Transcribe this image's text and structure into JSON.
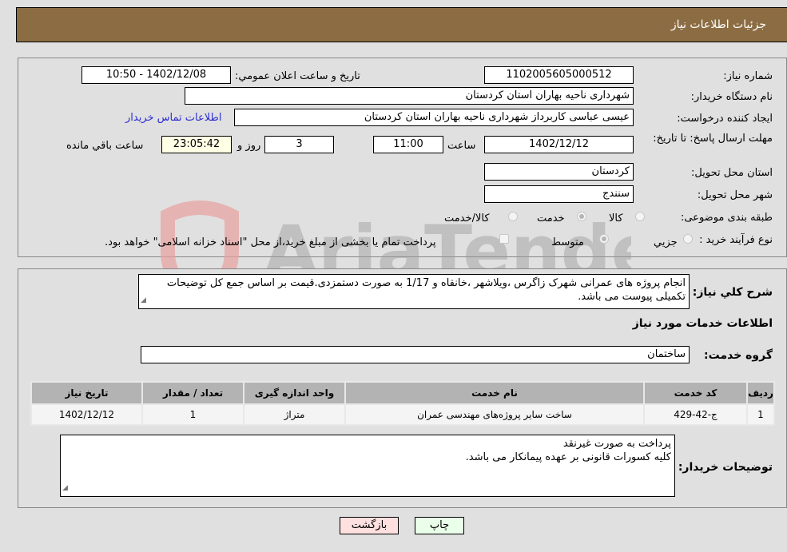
{
  "header": {
    "title": "جزئیات اطلاعات نیاز"
  },
  "form": {
    "need_number": {
      "label": "شماره نیاز:",
      "value": "1102005605000512"
    },
    "announce_datetime": {
      "label": "تاریخ و ساعت اعلان عمومي:",
      "value": "1402/12/08 - 10:50"
    },
    "buyer_org": {
      "label": "نام دستگاه خریدار:",
      "value": "شهرداری ناحیه بهاران استان کردستان"
    },
    "requester": {
      "label": "ایجاد کننده درخواست:",
      "value": "عیسی عباسی کاربرداز شهرداری ناحیه بهاران استان کردستان"
    },
    "buyer_contact_link": "اطلاعات تماس خریدار",
    "deadline": {
      "label": "مهلت ارسال پاسخ: تا تاریخ:",
      "date": "1402/12/12",
      "time_label": "ساعت",
      "time": "11:00",
      "days": "3",
      "days_label": "روز و",
      "remaining": "23:05:42",
      "remaining_label": "ساعت باقي مانده"
    },
    "delivery_province": {
      "label": "استان محل تحویل:",
      "value": "کردستان"
    },
    "delivery_city": {
      "label": "شهر محل تحویل:",
      "value": "سنندج"
    },
    "category": {
      "label": "طبقه بندی موضوعی:",
      "options": [
        "کالا",
        "خدمت",
        "کالا/خدمت"
      ],
      "selected": "خدمت"
    },
    "purchase_type": {
      "label": "نوع فرآیند خرید :",
      "options": [
        "جزيي",
        "متوسط"
      ],
      "selected": "متوسط",
      "treasury_note": "پرداخت تمام یا بخشی از مبلغ خرید،از محل \"اسناد خزانه اسلامی\" خواهد بود."
    }
  },
  "description": {
    "label": "شرح کلي نیاز:",
    "text": "انجام پروژه های عمرانی شهرک زاگرس ،ویلاشهر ،خانقاه و 1/17 به صورت دستمزدی.قیمت بر اساس جمع کل توضیحات تکمیلی پیوست می باشد."
  },
  "services": {
    "section_title": "اطلاعات خدمات مورد نیاز",
    "group_label": "گروه خدمت:",
    "group_value": "ساختمان",
    "table": {
      "headers": [
        "ردیف",
        "کد خدمت",
        "نام خدمت",
        "واحد اندازه گیری",
        "تعداد / مقدار",
        "تاریخ نیاز"
      ],
      "rows": [
        [
          "1",
          "ج-42-429",
          "ساخت سایر پروژه‌های مهندسی عمران",
          "متراژ",
          "1",
          "1402/12/12"
        ]
      ]
    }
  },
  "buyer_notes": {
    "label": "توضیحات خریدار:",
    "lines": [
      "پرداخت به صورت غیرنقد",
      "کلیه کسورات قانونی بر عهده پیمانکار می باشد."
    ]
  },
  "buttons": {
    "print": "چاپ",
    "back": "بازگشت"
  },
  "watermark": "AriaTender.neT"
}
